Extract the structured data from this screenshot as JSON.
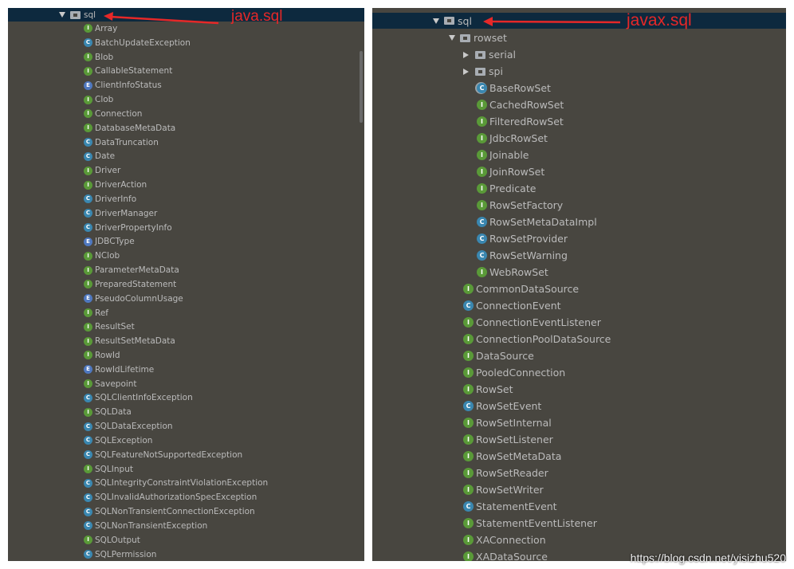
{
  "left_panel": {
    "root_label": "sql",
    "items": [
      {
        "label": "Array",
        "kind": "I",
        "icon": "interface-icon"
      },
      {
        "label": "BatchUpdateException",
        "kind": "C",
        "icon": "class-icon"
      },
      {
        "label": "Blob",
        "kind": "I",
        "icon": "interface-icon"
      },
      {
        "label": "CallableStatement",
        "kind": "I",
        "icon": "interface-icon"
      },
      {
        "label": "ClientInfoStatus",
        "kind": "E",
        "icon": "enum-icon"
      },
      {
        "label": "Clob",
        "kind": "I",
        "icon": "interface-icon"
      },
      {
        "label": "Connection",
        "kind": "I",
        "icon": "interface-icon"
      },
      {
        "label": "DatabaseMetaData",
        "kind": "I",
        "icon": "interface-icon"
      },
      {
        "label": "DataTruncation",
        "kind": "C",
        "icon": "class-icon"
      },
      {
        "label": "Date",
        "kind": "C",
        "icon": "class-icon"
      },
      {
        "label": "Driver",
        "kind": "I",
        "icon": "interface-icon"
      },
      {
        "label": "DriverAction",
        "kind": "I",
        "icon": "interface-icon"
      },
      {
        "label": "DriverInfo",
        "kind": "C",
        "icon": "class-icon"
      },
      {
        "label": "DriverManager",
        "kind": "C",
        "icon": "class-icon"
      },
      {
        "label": "DriverPropertyInfo",
        "kind": "C",
        "icon": "class-icon"
      },
      {
        "label": "JDBCType",
        "kind": "E",
        "icon": "enum-icon"
      },
      {
        "label": "NClob",
        "kind": "I",
        "icon": "interface-icon"
      },
      {
        "label": "ParameterMetaData",
        "kind": "I",
        "icon": "interface-icon"
      },
      {
        "label": "PreparedStatement",
        "kind": "I",
        "icon": "interface-icon"
      },
      {
        "label": "PseudoColumnUsage",
        "kind": "E",
        "icon": "enum-icon"
      },
      {
        "label": "Ref",
        "kind": "I",
        "icon": "interface-icon"
      },
      {
        "label": "ResultSet",
        "kind": "I",
        "icon": "interface-icon"
      },
      {
        "label": "ResultSetMetaData",
        "kind": "I",
        "icon": "interface-icon"
      },
      {
        "label": "RowId",
        "kind": "I",
        "icon": "interface-icon"
      },
      {
        "label": "RowIdLifetime",
        "kind": "E",
        "icon": "enum-icon"
      },
      {
        "label": "Savepoint",
        "kind": "I",
        "icon": "interface-icon"
      },
      {
        "label": "SQLClientInfoException",
        "kind": "C",
        "icon": "class-icon"
      },
      {
        "label": "SQLData",
        "kind": "I",
        "icon": "interface-icon"
      },
      {
        "label": "SQLDataException",
        "kind": "C",
        "icon": "class-icon"
      },
      {
        "label": "SQLException",
        "kind": "C",
        "icon": "class-icon"
      },
      {
        "label": "SQLFeatureNotSupportedException",
        "kind": "C",
        "icon": "class-icon"
      },
      {
        "label": "SQLInput",
        "kind": "I",
        "icon": "interface-icon"
      },
      {
        "label": "SQLIntegrityConstraintViolationException",
        "kind": "C",
        "icon": "class-icon"
      },
      {
        "label": "SQLInvalidAuthorizationSpecException",
        "kind": "C",
        "icon": "class-icon"
      },
      {
        "label": "SQLNonTransientConnectionException",
        "kind": "C",
        "icon": "class-icon"
      },
      {
        "label": "SQLNonTransientException",
        "kind": "C",
        "icon": "class-icon"
      },
      {
        "label": "SQLOutput",
        "kind": "I",
        "icon": "interface-icon"
      },
      {
        "label": "SQLPermission",
        "kind": "C",
        "icon": "class-icon"
      }
    ]
  },
  "right_panel": {
    "root_label": "sql",
    "rowset": {
      "label": "rowset",
      "subpackages": [
        {
          "label": "serial"
        },
        {
          "label": "spi"
        }
      ],
      "items": [
        {
          "label": "BaseRowSet",
          "kind": "A",
          "icon": "abstract-class-icon"
        },
        {
          "label": "CachedRowSet",
          "kind": "I",
          "icon": "interface-icon"
        },
        {
          "label": "FilteredRowSet",
          "kind": "I",
          "icon": "interface-icon"
        },
        {
          "label": "JdbcRowSet",
          "kind": "I",
          "icon": "interface-icon"
        },
        {
          "label": "Joinable",
          "kind": "I",
          "icon": "interface-icon"
        },
        {
          "label": "JoinRowSet",
          "kind": "I",
          "icon": "interface-icon"
        },
        {
          "label": "Predicate",
          "kind": "I",
          "icon": "interface-icon"
        },
        {
          "label": "RowSetFactory",
          "kind": "I",
          "icon": "interface-icon"
        },
        {
          "label": "RowSetMetaDataImpl",
          "kind": "C",
          "icon": "class-icon"
        },
        {
          "label": "RowSetProvider",
          "kind": "C",
          "icon": "class-icon"
        },
        {
          "label": "RowSetWarning",
          "kind": "C",
          "icon": "class-icon"
        },
        {
          "label": "WebRowSet",
          "kind": "I",
          "icon": "interface-icon"
        }
      ]
    },
    "items": [
      {
        "label": "CommonDataSource",
        "kind": "I",
        "icon": "interface-icon"
      },
      {
        "label": "ConnectionEvent",
        "kind": "C",
        "icon": "class-icon"
      },
      {
        "label": "ConnectionEventListener",
        "kind": "I",
        "icon": "interface-icon"
      },
      {
        "label": "ConnectionPoolDataSource",
        "kind": "I",
        "icon": "interface-icon"
      },
      {
        "label": "DataSource",
        "kind": "I",
        "icon": "interface-icon"
      },
      {
        "label": "PooledConnection",
        "kind": "I",
        "icon": "interface-icon"
      },
      {
        "label": "RowSet",
        "kind": "I",
        "icon": "interface-icon"
      },
      {
        "label": "RowSetEvent",
        "kind": "C",
        "icon": "class-icon"
      },
      {
        "label": "RowSetInternal",
        "kind": "I",
        "icon": "interface-icon"
      },
      {
        "label": "RowSetListener",
        "kind": "I",
        "icon": "interface-icon"
      },
      {
        "label": "RowSetMetaData",
        "kind": "I",
        "icon": "interface-icon"
      },
      {
        "label": "RowSetReader",
        "kind": "I",
        "icon": "interface-icon"
      },
      {
        "label": "RowSetWriter",
        "kind": "I",
        "icon": "interface-icon"
      },
      {
        "label": "StatementEvent",
        "kind": "C",
        "icon": "class-icon"
      },
      {
        "label": "StatementEventListener",
        "kind": "I",
        "icon": "interface-icon"
      },
      {
        "label": "XAConnection",
        "kind": "I",
        "icon": "interface-icon"
      },
      {
        "label": "XADataSource",
        "kind": "I",
        "icon": "interface-icon"
      }
    ]
  },
  "annotations": {
    "left_label": "java.sql",
    "right_label": "javax.sql",
    "color": "#e52828"
  },
  "watermark": "https://blog.csdn.net/yisizhu520",
  "colors": {
    "panel_bg": "#484640",
    "selected_bg": "#0d293e",
    "text": "#bbbbbb",
    "interface": "#5a9a38",
    "class": "#3a87b0",
    "enum": "#4f78bf"
  }
}
